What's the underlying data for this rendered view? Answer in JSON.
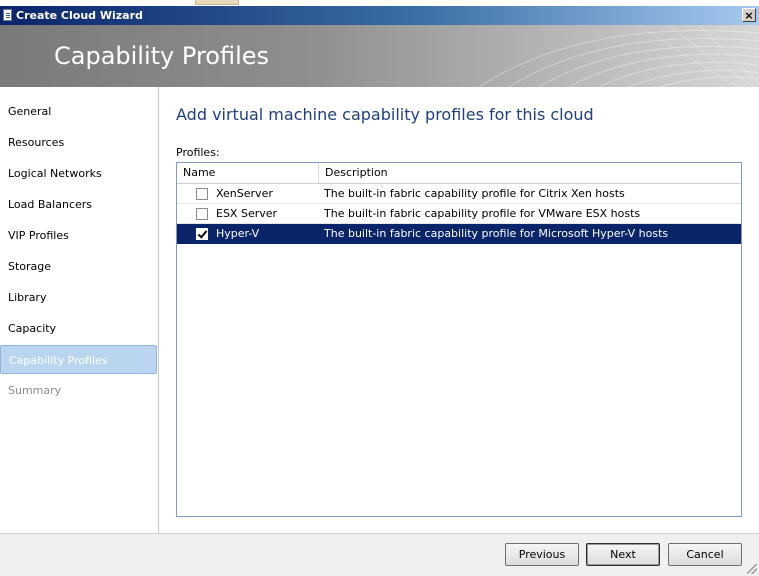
{
  "window": {
    "title": "Create Cloud Wizard",
    "close_glyph": "×"
  },
  "banner": {
    "title": "Capability Profiles"
  },
  "sidebar": {
    "items": [
      {
        "label": "General",
        "state": "normal"
      },
      {
        "label": "Resources",
        "state": "normal"
      },
      {
        "label": "Logical Networks",
        "state": "normal"
      },
      {
        "label": "Load Balancers",
        "state": "normal"
      },
      {
        "label": "VIP Profiles",
        "state": "normal"
      },
      {
        "label": "Storage",
        "state": "normal"
      },
      {
        "label": "Library",
        "state": "normal"
      },
      {
        "label": "Capacity",
        "state": "normal"
      },
      {
        "label": "Capability Profiles",
        "state": "active"
      },
      {
        "label": "Summary",
        "state": "disabled"
      }
    ]
  },
  "main": {
    "heading": "Add virtual machine capability profiles for this cloud",
    "profiles_label": "Profiles:",
    "columns": {
      "name": "Name",
      "description": "Description"
    },
    "rows": [
      {
        "checked": false,
        "selected": false,
        "name": "XenServer",
        "description": "The built-in fabric capability profile for Citrix Xen hosts"
      },
      {
        "checked": false,
        "selected": false,
        "name": "ESX Server",
        "description": "The built-in fabric capability profile for VMware ESX hosts"
      },
      {
        "checked": true,
        "selected": true,
        "name": "Hyper-V",
        "description": "The built-in fabric capability profile for Microsoft Hyper-V hosts"
      }
    ]
  },
  "footer": {
    "previous_label": "Previous",
    "next_label": "Next",
    "cancel_label": "Cancel"
  },
  "colors": {
    "title_bar": "#0a246a",
    "selected_row": "#0a246a",
    "heading": "#1f3f7f",
    "active_nav": "#b9d5f0"
  }
}
